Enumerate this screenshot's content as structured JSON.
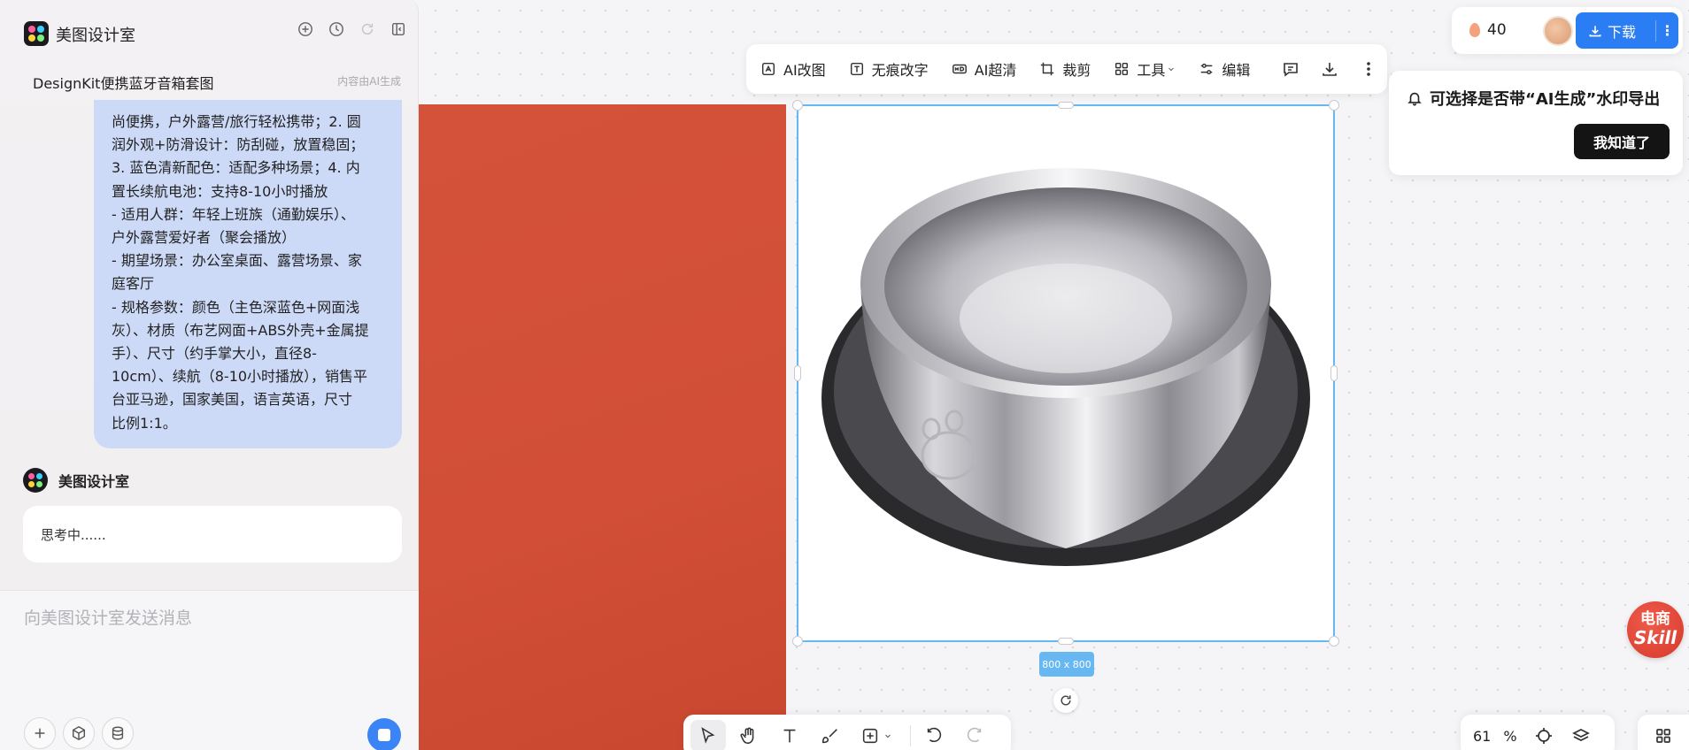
{
  "app": {
    "name": "美图设计室",
    "project_title": "DesignKit便携蓝牙音箱套图",
    "ai_note": "内容由AI生成"
  },
  "chat": {
    "user_message_lines": [
      "尚便携，户外露营/旅行轻松携带；2. 圆",
      "润外观+防滑设计：防刮碰，放置稳固；",
      "3. 蓝色清新配色：适配多种场景；4. 内",
      "置长续航电池：支持8-10小时播放",
      "- 适用人群：年轻上班族（通勤娱乐）、",
      "户外露营爱好者（聚会播放）",
      "- 期望场景：办公室桌面、露营场景、家",
      "庭客厅",
      "- 规格参数：颜色（主色深蓝色+网面浅",
      "灰）、材质（布艺网面+ABS外壳+金属提",
      "手）、尺寸（约手掌大小，直径8-",
      "10cm）、续航（8-10小时播放），销售平",
      "台亚马逊，国家美国，语言英语，尺寸",
      "比例1:1。"
    ],
    "bot_name": "美图设计室",
    "bot_status": "思考中......",
    "input_placeholder": "向美图设计室发送消息"
  },
  "image_toolbar": {
    "items": [
      {
        "label": "AI改图",
        "icon": "ai-edit-icon"
      },
      {
        "label": "无痕改字",
        "icon": "text-edit-icon"
      },
      {
        "label": "AI超清",
        "icon": "hd-icon"
      },
      {
        "label": "裁剪",
        "icon": "crop-icon"
      },
      {
        "label": "工具",
        "icon": "tools-grid-icon"
      },
      {
        "label": "编辑",
        "icon": "sliders-icon"
      }
    ]
  },
  "top_right": {
    "credits": "40",
    "download_label": "下载",
    "more_label": "⋮"
  },
  "tip": {
    "text": "可选择是否带“AI生成”水印导出",
    "button": "我知道了"
  },
  "canvas": {
    "selection_size": "800 x 800"
  },
  "badge": {
    "line1": "电商",
    "line2": "Skill"
  },
  "zoom": {
    "value": "61",
    "unit": "%"
  },
  "colors": {
    "accent": "#2b7df3",
    "selection": "#63b8f5",
    "user_bubble": "#cddaf7",
    "red_image": "#d24e36"
  }
}
